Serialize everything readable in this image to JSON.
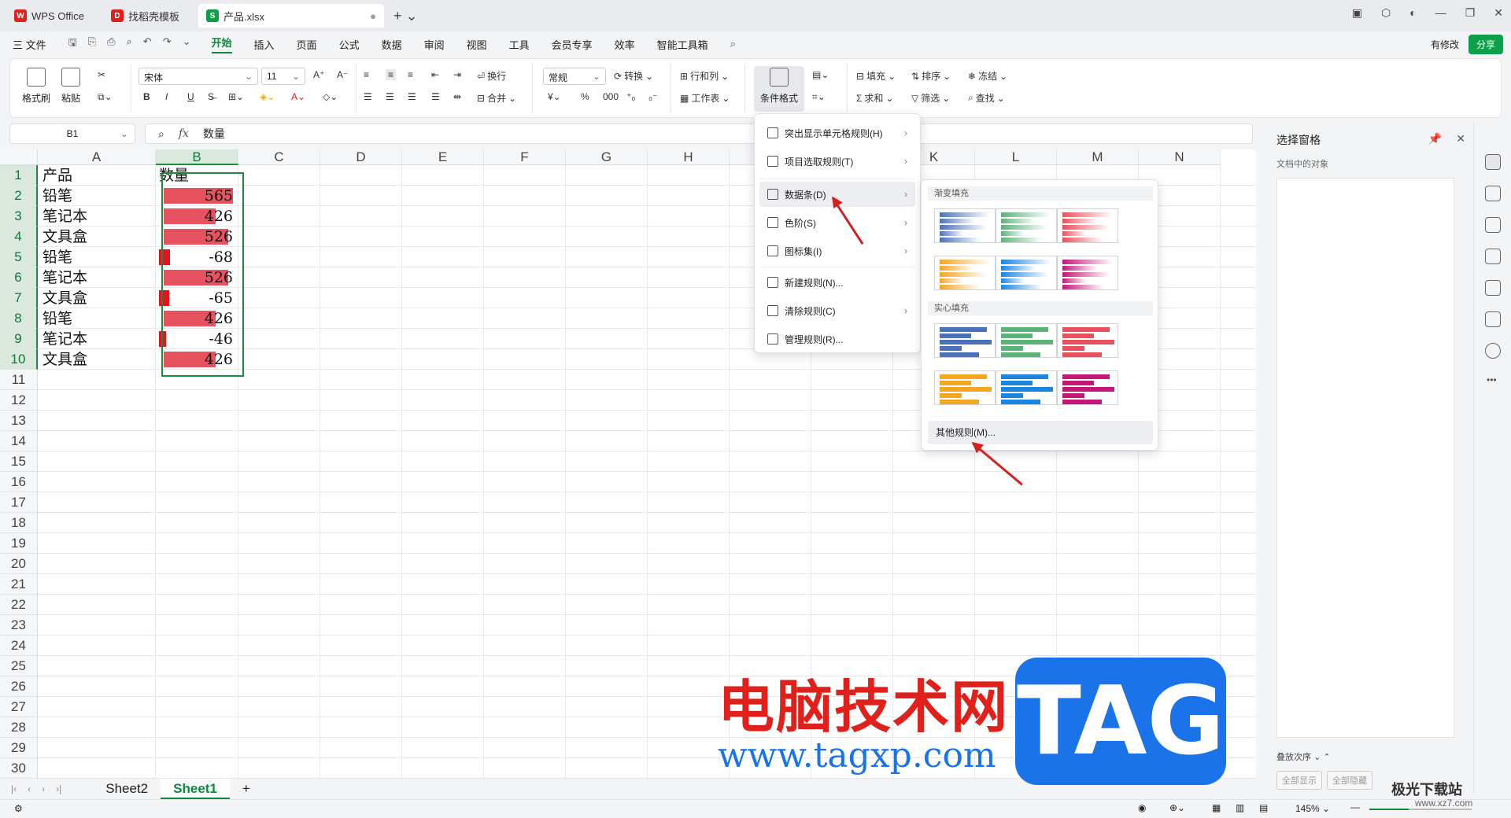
{
  "tabs": [
    {
      "label": "WPS Office",
      "color": "#e0201a",
      "logo": "W"
    },
    {
      "label": "找稻壳模板",
      "color": "#e0201a",
      "logo": "D"
    },
    {
      "label": "产品.xlsx",
      "color": "#0e9f4a",
      "logo": "S"
    }
  ],
  "menubar": {
    "file": "三 文件",
    "items": [
      "开始",
      "插入",
      "页面",
      "公式",
      "数据",
      "审阅",
      "视图",
      "工具",
      "会员专享",
      "效率",
      "智能工具箱"
    ],
    "active": "开始",
    "status_text": "有修改",
    "share": "分享"
  },
  "ribbon": {
    "format_painter": "格式刷",
    "paste": "粘贴",
    "font_name": "宋体",
    "font_size": "11",
    "wrap": "换行",
    "merge": "合并",
    "number_format": "常规",
    "convert": "转换",
    "row_col": "行和列",
    "worksheet": "工作表",
    "cond_format": "条件格式",
    "fill": "填充",
    "sort": "排序",
    "freeze": "冻结",
    "sum": "求和",
    "filter": "筛选",
    "find": "查找",
    "bold": "B",
    "italic": "I",
    "underline": "U"
  },
  "formula_bar": {
    "cell_ref": "B1",
    "fx": "fx",
    "content": "数量"
  },
  "columns": [
    "A",
    "B",
    "C",
    "D",
    "E",
    "F",
    "G",
    "H",
    "I",
    "J",
    "K",
    "L",
    "M",
    "N"
  ],
  "rows": [
    "1",
    "2",
    "3",
    "4",
    "5",
    "6",
    "7",
    "8",
    "9",
    "10",
    "11",
    "12",
    "13",
    "14",
    "15",
    "16",
    "17",
    "18",
    "19",
    "20",
    "21",
    "22",
    "23",
    "24",
    "25",
    "26",
    "27",
    "28",
    "29",
    "30"
  ],
  "table": {
    "header": {
      "product": "产品",
      "qty": "数量"
    },
    "data": [
      {
        "product": "铅笔",
        "qty": 565
      },
      {
        "product": "笔记本",
        "qty": 426
      },
      {
        "product": "文具盒",
        "qty": 526
      },
      {
        "product": "铅笔",
        "qty": -68
      },
      {
        "product": "笔记本",
        "qty": 526
      },
      {
        "product": "文具盒",
        "qty": -65
      },
      {
        "product": "铅笔",
        "qty": 426
      },
      {
        "product": "笔记本",
        "qty": -46
      },
      {
        "product": "文具盒",
        "qty": 426
      }
    ],
    "bar_color": "#e6525f",
    "neg_bar_color": "#e8101a"
  },
  "context_menu": [
    {
      "label": "突出显示单元格规则(H)",
      "arrow": true
    },
    {
      "label": "项目选取规则(T)",
      "arrow": true
    },
    {
      "label": "数据条(D)",
      "arrow": true
    },
    {
      "label": "色阶(S)",
      "arrow": true
    },
    {
      "label": "图标集(I)",
      "arrow": true
    },
    {
      "label": "新建规则(N)...",
      "arrow": false
    },
    {
      "label": "清除规则(C)",
      "arrow": true
    },
    {
      "label": "管理规则(R)...",
      "arrow": false
    }
  ],
  "submenu": {
    "gradient_title": "渐变填充",
    "solid_title": "实心填充",
    "more": "其他规则(M)...",
    "colors": [
      "#4a72b8",
      "#5cb37a",
      "#e8505b",
      "#f4a623",
      "#1a86e0",
      "#c3177a"
    ]
  },
  "right_panel": {
    "title": "选择窗格",
    "subtitle": "文档中的对象",
    "order_label": "叠放次序",
    "show_all": "全部显示",
    "hide_all": "全部隐藏"
  },
  "sheets": {
    "tabs": [
      "Sheet2",
      "Sheet1"
    ],
    "active": "Sheet1",
    "add": "+"
  },
  "status": {
    "zoom": "145%"
  },
  "watermark": {
    "cn": "电脑技术网",
    "url": "www.tagxp.com",
    "tag": "TAG",
    "brand": "极光下载站",
    "brand_url": "www.xz7.com"
  }
}
